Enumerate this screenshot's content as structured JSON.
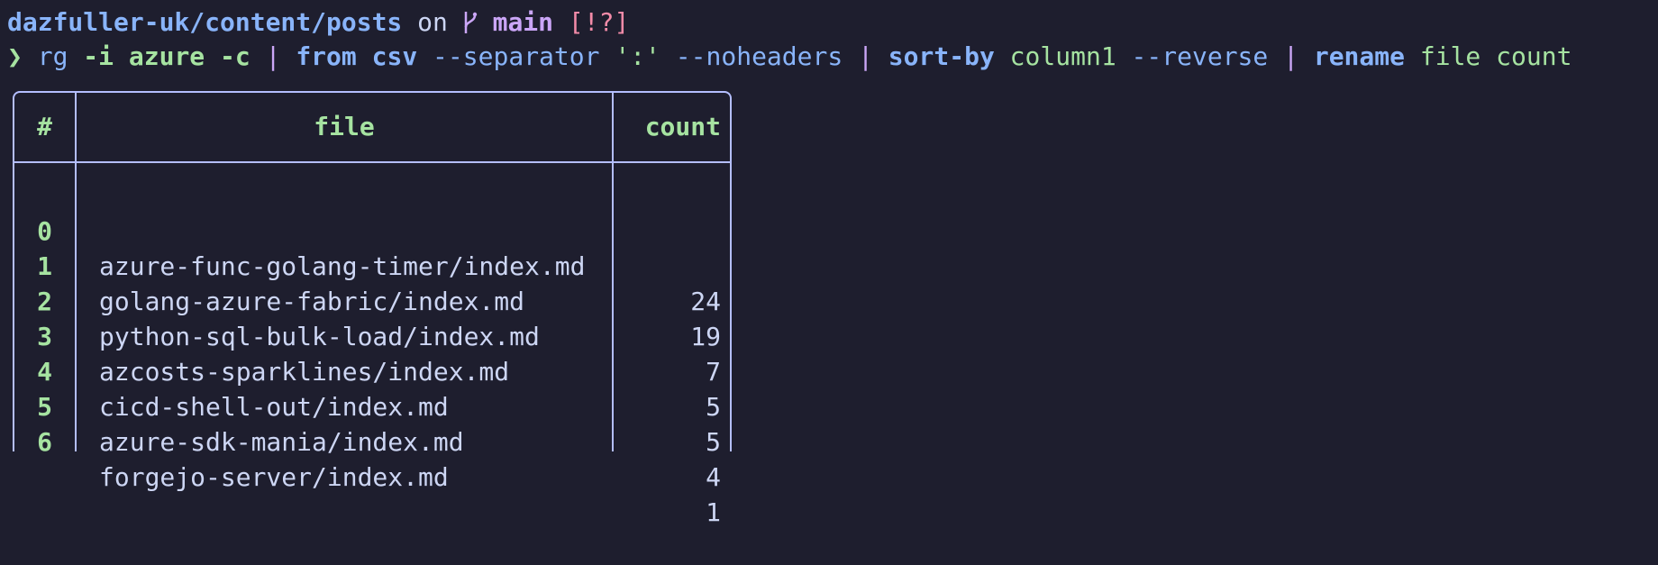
{
  "prompt": {
    "path": "dazfuller-uk/content/posts",
    "on": "on",
    "branch_icon": "",
    "branch": "main",
    "git_status": "[!?]"
  },
  "command": {
    "chevron": "❯",
    "rg": "rg",
    "flag_i": "-i",
    "pattern": "azure",
    "flag_c": "-c",
    "pipe": "|",
    "from": "from csv",
    "separator_flag": "--separator",
    "separator_value": "':'",
    "noheaders": "--noheaders",
    "sort_by": "sort-by",
    "sort_column": "column1",
    "reverse": "--reverse",
    "rename": "rename",
    "rename_args": "file count"
  },
  "table": {
    "headers": {
      "index": "#",
      "file": "file",
      "count": "count"
    },
    "rows": [
      {
        "index": "0",
        "file": "azure-func-golang-timer/index.md",
        "count": "24"
      },
      {
        "index": "1",
        "file": "golang-azure-fabric/index.md",
        "count": "19"
      },
      {
        "index": "2",
        "file": "python-sql-bulk-load/index.md",
        "count": "7"
      },
      {
        "index": "3",
        "file": "azcosts-sparklines/index.md",
        "count": "5"
      },
      {
        "index": "4",
        "file": "cicd-shell-out/index.md",
        "count": "5"
      },
      {
        "index": "5",
        "file": "azure-sdk-mania/index.md",
        "count": "4"
      },
      {
        "index": "6",
        "file": "forgejo-server/index.md",
        "count": "1"
      }
    ]
  },
  "colors": {
    "background": "#1e1e2e",
    "path": "#89b4fa",
    "branch": "#cba6f7",
    "git_status": "#f38ba8",
    "green": "#a6e3a1",
    "border": "#b4befe"
  },
  "icons": {
    "branch": "git-branch-icon",
    "prompt": "chevron-right-icon"
  }
}
